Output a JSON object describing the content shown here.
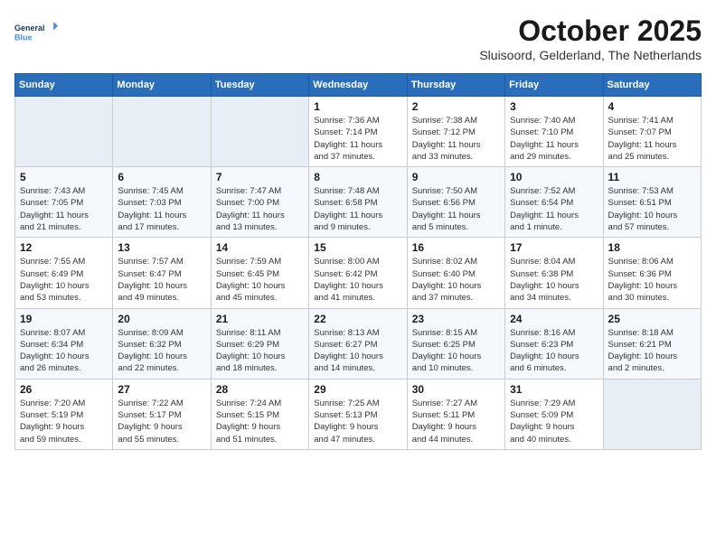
{
  "header": {
    "logo_line1": "General",
    "logo_line2": "Blue",
    "month": "October 2025",
    "location": "Sluisoord, Gelderland, The Netherlands"
  },
  "weekdays": [
    "Sunday",
    "Monday",
    "Tuesday",
    "Wednesday",
    "Thursday",
    "Friday",
    "Saturday"
  ],
  "weeks": [
    [
      {
        "day": "",
        "info": ""
      },
      {
        "day": "",
        "info": ""
      },
      {
        "day": "",
        "info": ""
      },
      {
        "day": "1",
        "info": "Sunrise: 7:36 AM\nSunset: 7:14 PM\nDaylight: 11 hours\nand 37 minutes."
      },
      {
        "day": "2",
        "info": "Sunrise: 7:38 AM\nSunset: 7:12 PM\nDaylight: 11 hours\nand 33 minutes."
      },
      {
        "day": "3",
        "info": "Sunrise: 7:40 AM\nSunset: 7:10 PM\nDaylight: 11 hours\nand 29 minutes."
      },
      {
        "day": "4",
        "info": "Sunrise: 7:41 AM\nSunset: 7:07 PM\nDaylight: 11 hours\nand 25 minutes."
      }
    ],
    [
      {
        "day": "5",
        "info": "Sunrise: 7:43 AM\nSunset: 7:05 PM\nDaylight: 11 hours\nand 21 minutes."
      },
      {
        "day": "6",
        "info": "Sunrise: 7:45 AM\nSunset: 7:03 PM\nDaylight: 11 hours\nand 17 minutes."
      },
      {
        "day": "7",
        "info": "Sunrise: 7:47 AM\nSunset: 7:00 PM\nDaylight: 11 hours\nand 13 minutes."
      },
      {
        "day": "8",
        "info": "Sunrise: 7:48 AM\nSunset: 6:58 PM\nDaylight: 11 hours\nand 9 minutes."
      },
      {
        "day": "9",
        "info": "Sunrise: 7:50 AM\nSunset: 6:56 PM\nDaylight: 11 hours\nand 5 minutes."
      },
      {
        "day": "10",
        "info": "Sunrise: 7:52 AM\nSunset: 6:54 PM\nDaylight: 11 hours\nand 1 minute."
      },
      {
        "day": "11",
        "info": "Sunrise: 7:53 AM\nSunset: 6:51 PM\nDaylight: 10 hours\nand 57 minutes."
      }
    ],
    [
      {
        "day": "12",
        "info": "Sunrise: 7:55 AM\nSunset: 6:49 PM\nDaylight: 10 hours\nand 53 minutes."
      },
      {
        "day": "13",
        "info": "Sunrise: 7:57 AM\nSunset: 6:47 PM\nDaylight: 10 hours\nand 49 minutes."
      },
      {
        "day": "14",
        "info": "Sunrise: 7:59 AM\nSunset: 6:45 PM\nDaylight: 10 hours\nand 45 minutes."
      },
      {
        "day": "15",
        "info": "Sunrise: 8:00 AM\nSunset: 6:42 PM\nDaylight: 10 hours\nand 41 minutes."
      },
      {
        "day": "16",
        "info": "Sunrise: 8:02 AM\nSunset: 6:40 PM\nDaylight: 10 hours\nand 37 minutes."
      },
      {
        "day": "17",
        "info": "Sunrise: 8:04 AM\nSunset: 6:38 PM\nDaylight: 10 hours\nand 34 minutes."
      },
      {
        "day": "18",
        "info": "Sunrise: 8:06 AM\nSunset: 6:36 PM\nDaylight: 10 hours\nand 30 minutes."
      }
    ],
    [
      {
        "day": "19",
        "info": "Sunrise: 8:07 AM\nSunset: 6:34 PM\nDaylight: 10 hours\nand 26 minutes."
      },
      {
        "day": "20",
        "info": "Sunrise: 8:09 AM\nSunset: 6:32 PM\nDaylight: 10 hours\nand 22 minutes."
      },
      {
        "day": "21",
        "info": "Sunrise: 8:11 AM\nSunset: 6:29 PM\nDaylight: 10 hours\nand 18 minutes."
      },
      {
        "day": "22",
        "info": "Sunrise: 8:13 AM\nSunset: 6:27 PM\nDaylight: 10 hours\nand 14 minutes."
      },
      {
        "day": "23",
        "info": "Sunrise: 8:15 AM\nSunset: 6:25 PM\nDaylight: 10 hours\nand 10 minutes."
      },
      {
        "day": "24",
        "info": "Sunrise: 8:16 AM\nSunset: 6:23 PM\nDaylight: 10 hours\nand 6 minutes."
      },
      {
        "day": "25",
        "info": "Sunrise: 8:18 AM\nSunset: 6:21 PM\nDaylight: 10 hours\nand 2 minutes."
      }
    ],
    [
      {
        "day": "26",
        "info": "Sunrise: 7:20 AM\nSunset: 5:19 PM\nDaylight: 9 hours\nand 59 minutes."
      },
      {
        "day": "27",
        "info": "Sunrise: 7:22 AM\nSunset: 5:17 PM\nDaylight: 9 hours\nand 55 minutes."
      },
      {
        "day": "28",
        "info": "Sunrise: 7:24 AM\nSunset: 5:15 PM\nDaylight: 9 hours\nand 51 minutes."
      },
      {
        "day": "29",
        "info": "Sunrise: 7:25 AM\nSunset: 5:13 PM\nDaylight: 9 hours\nand 47 minutes."
      },
      {
        "day": "30",
        "info": "Sunrise: 7:27 AM\nSunset: 5:11 PM\nDaylight: 9 hours\nand 44 minutes."
      },
      {
        "day": "31",
        "info": "Sunrise: 7:29 AM\nSunset: 5:09 PM\nDaylight: 9 hours\nand 40 minutes."
      },
      {
        "day": "",
        "info": ""
      }
    ]
  ]
}
